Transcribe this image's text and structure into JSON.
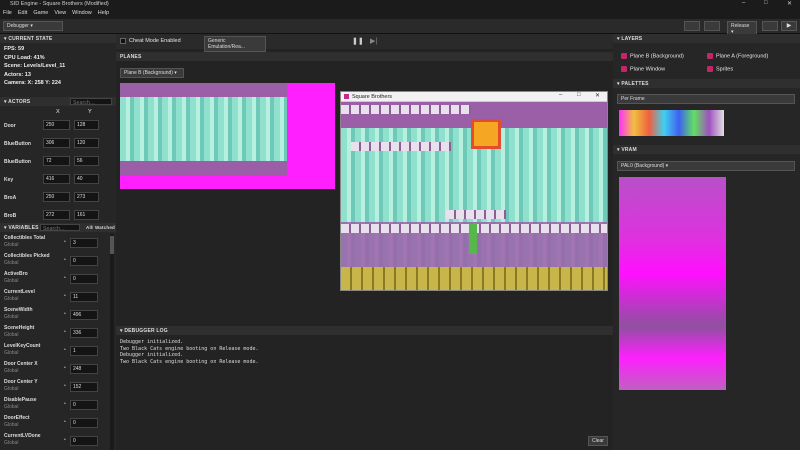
{
  "app": {
    "title": "SID Engine - Square Brothers (Modified)"
  },
  "menu": [
    "File",
    "Edit",
    "Game",
    "View",
    "Window",
    "Help"
  ],
  "toolbar": {
    "mode": "Debugger",
    "build": "Release"
  },
  "left": {
    "stats_header": "CURRENT STATE",
    "fps": "FPS: 59",
    "cpu": "CPU Load: 41%",
    "scene": "Scene: Levels/Level_11",
    "actors": "Actors: 13",
    "camera": "Camera: X: 258 Y: 224",
    "actors_header": "ACTORS",
    "actors_search": "Search...",
    "x_col": "X",
    "y_col": "Y",
    "actor_rows": [
      {
        "name": "Door",
        "x": "250",
        "y": "128"
      },
      {
        "name": "BlueButton",
        "x": "306",
        "y": "120"
      },
      {
        "name": "BlueButton",
        "x": "72",
        "y": "56"
      },
      {
        "name": "Key",
        "x": "416",
        "y": "40"
      },
      {
        "name": "BroA",
        "x": "250",
        "y": "273"
      },
      {
        "name": "BroB",
        "x": "272",
        "y": "161"
      }
    ],
    "variables_header": "VARIABLES",
    "vars_search": "Search...",
    "filter_all": "All",
    "filter_watched": "Watched",
    "vars": [
      {
        "name": "Collectibles Total",
        "scope": "Global",
        "value": "3"
      },
      {
        "name": "Collectibles Picked",
        "scope": "Global",
        "value": "0"
      },
      {
        "name": "ActiveBro",
        "scope": "Global",
        "value": "0"
      },
      {
        "name": "CurrentLevel",
        "scope": "Global",
        "value": "11"
      },
      {
        "name": "SceneWidth",
        "scope": "Global",
        "value": "496"
      },
      {
        "name": "SceneHeight",
        "scope": "Global",
        "value": "336"
      },
      {
        "name": "LevelKeyCount",
        "scope": "Global",
        "value": "1"
      },
      {
        "name": "Door Center X",
        "scope": "Global",
        "value": "248"
      },
      {
        "name": "Door Center Y",
        "scope": "Global",
        "value": "152"
      },
      {
        "name": "DisablePause",
        "scope": "Global",
        "value": "0"
      },
      {
        "name": "DoorEffect",
        "scope": "Global",
        "value": "0"
      },
      {
        "name": "CurrentLVDone",
        "scope": "Global",
        "value": "0"
      }
    ]
  },
  "center": {
    "cheat": "Cheat Mode Enabled",
    "emu": "Generic Emulation/Rea...",
    "planes_header": "PLANES",
    "plane_select": "Plane B (Background)",
    "game_title": "Square Brothers",
    "log_header": "DEBUGGER LOG",
    "log_lines": [
      "Debugger initialized.",
      "Two Black Cats engine booting on Release mode.",
      "Debugger initialized.",
      "Two Black Cats engine booting on Release mode."
    ],
    "clear": "Clear"
  },
  "right": {
    "layers_header": "LAYERS",
    "layers": [
      "Plane B (Background)",
      "Plane A (Foreground)",
      "Plane Window",
      "Sprites"
    ],
    "palettes_header": "PALETTES",
    "palette_select": "Per Frame",
    "vram_header": "VRAM",
    "vram_select": "PAL0 (Background)"
  }
}
